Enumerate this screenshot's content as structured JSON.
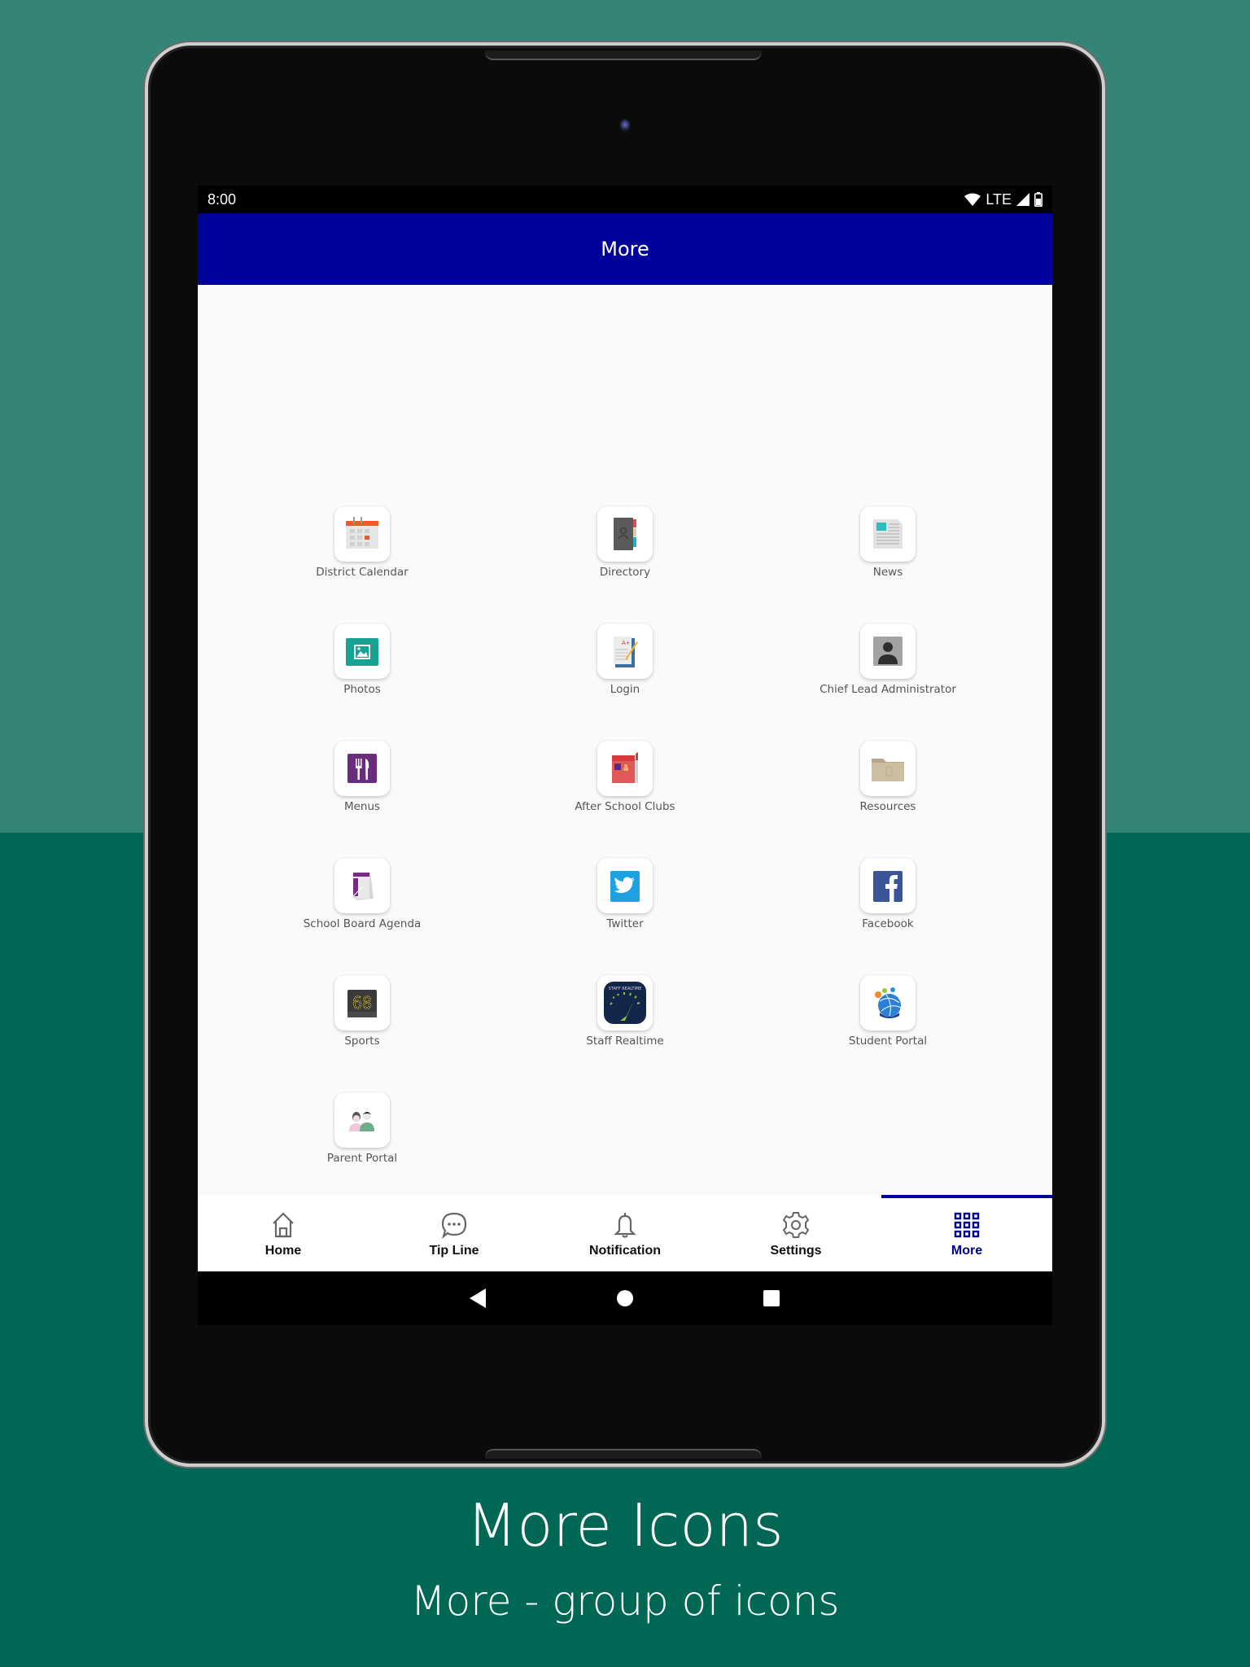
{
  "status_bar": {
    "time": "8:00",
    "network": "LTE",
    "icons": [
      "wifi-icon",
      "signal-icon",
      "battery-icon"
    ]
  },
  "app_bar": {
    "title": "More"
  },
  "colors": {
    "app_bar": "#00009b",
    "active_tab": "#00008b",
    "background_top": "#348577",
    "background_bottom": "#006755"
  },
  "tiles": [
    {
      "label": "District Calendar",
      "icon": "calendar-icon"
    },
    {
      "label": "Directory",
      "icon": "directory-book-icon"
    },
    {
      "label": "News",
      "icon": "newspaper-icon"
    },
    {
      "label": "Photos",
      "icon": "photo-icon"
    },
    {
      "label": "Login",
      "icon": "login-notebook-icon"
    },
    {
      "label": "Chief Lead Administrator",
      "icon": "administrator-icon"
    },
    {
      "label": "Menus",
      "icon": "fork-knife-icon"
    },
    {
      "label": "After School Clubs",
      "icon": "club-booth-icon"
    },
    {
      "label": "Resources",
      "icon": "folder-icon"
    },
    {
      "label": "School Board Agenda",
      "icon": "agenda-icon"
    },
    {
      "label": "Twitter",
      "icon": "twitter-icon"
    },
    {
      "label": "Facebook",
      "icon": "facebook-icon"
    },
    {
      "label": "Sports",
      "icon": "scoreboard-icon"
    },
    {
      "label": "Staff Realtime",
      "icon": "gauge-icon"
    },
    {
      "label": "Student Portal",
      "icon": "globe-people-icon"
    },
    {
      "label": "Parent Portal",
      "icon": "parents-icon"
    }
  ],
  "tabs": [
    {
      "label": "Home",
      "icon": "home-icon",
      "active": false
    },
    {
      "label": "Tip Line",
      "icon": "chat-bubble-icon",
      "active": false
    },
    {
      "label": "Notification",
      "icon": "bell-icon",
      "active": false
    },
    {
      "label": "Settings",
      "icon": "gear-icon",
      "active": false
    },
    {
      "label": "More",
      "icon": "grid-icon",
      "active": true
    }
  ],
  "scoreboard_text": "68",
  "caption": {
    "title": "More Icons",
    "subtitle": "More - group of icons"
  }
}
